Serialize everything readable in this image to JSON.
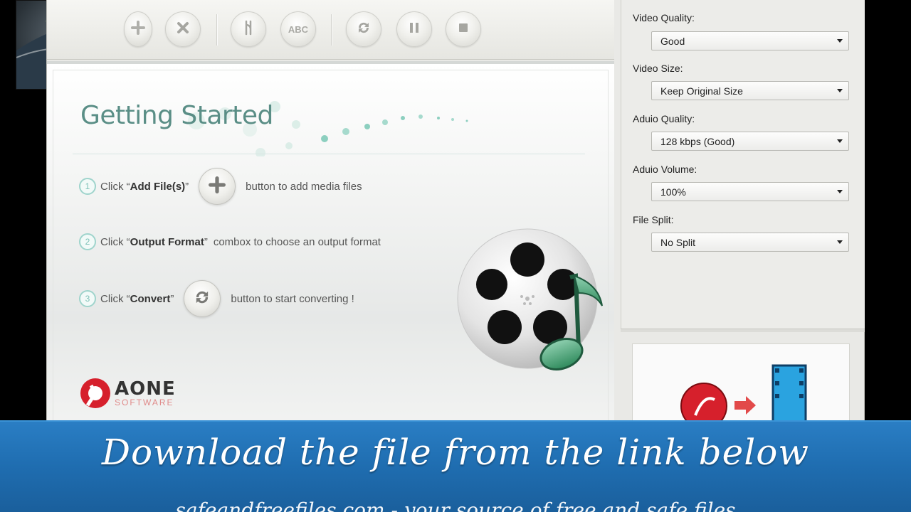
{
  "toolbar": {
    "buttons": [
      "add-icon",
      "remove-icon",
      "clip-icon",
      "abc-icon",
      "convert-icon",
      "pause-icon",
      "stop-icon"
    ],
    "abc_label": "ABC"
  },
  "getting_started": {
    "title": "Getting Started",
    "steps": [
      {
        "num": "1",
        "pre": "Click “",
        "bold": "Add File(s)",
        "post_quote": "”",
        "after": "button to add media files"
      },
      {
        "num": "2",
        "pre": "Click “",
        "bold": "Output Format",
        "post_quote": "”",
        "after": "combox to choose an output format"
      },
      {
        "num": "3",
        "pre": "Click “",
        "bold": "Convert",
        "post_quote": "”",
        "after": "button to start converting !"
      }
    ]
  },
  "logo": {
    "name": "AONE",
    "sub": "SOFTWARE"
  },
  "settings": {
    "video_quality": {
      "label": "Video Quality:",
      "value": "Good"
    },
    "video_size": {
      "label": "Video Size:",
      "value": "Keep Original Size"
    },
    "audio_quality": {
      "label": "Aduio Quality:",
      "value": "128 kbps (Good)"
    },
    "audio_volume": {
      "label": "Aduio Volume:",
      "value": "100%"
    },
    "file_split": {
      "label": "File Split:",
      "value": "No Split"
    }
  },
  "banner": {
    "title": "Download the file from the link below",
    "subtitle": "safeandfreefiles.com - your source of free and safe files"
  },
  "colors": {
    "accent": "#5a8e86",
    "banner": "#1f6db0"
  }
}
